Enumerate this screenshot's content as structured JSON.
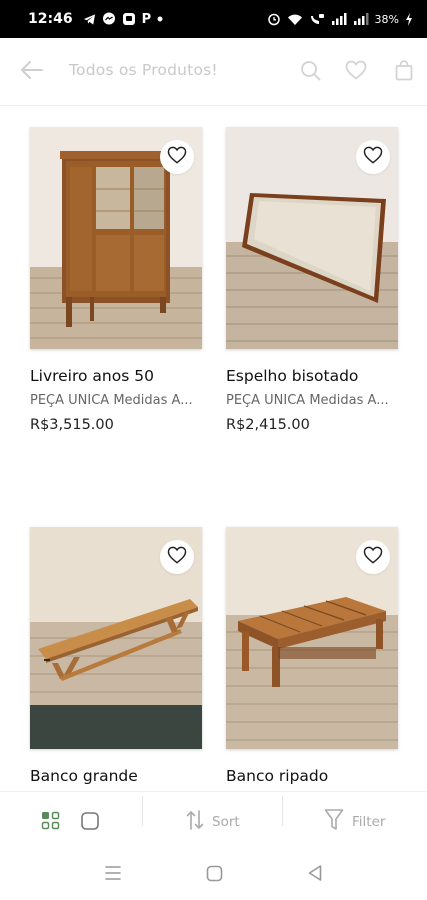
{
  "status_bar": {
    "time": "12:46",
    "left_icons": [
      "telegram-icon",
      "messenger-icon",
      "chat-app-icon",
      "p-app-icon",
      "dot-icon"
    ],
    "p_letter": "P",
    "battery": "38%",
    "right_icons": [
      "alarm-icon",
      "wifi-icon",
      "volte-icon",
      "signal-icon",
      "signal-icon",
      "battery-charging-icon"
    ]
  },
  "header": {
    "title": "Todos os Produtos!",
    "icons": [
      "back-arrow-icon",
      "search-icon",
      "heart-icon",
      "shopping-bag-icon"
    ]
  },
  "products": [
    {
      "title": "Livreiro anos 50",
      "description": "PEÇA ÚNICA Medidas A...",
      "price": "R$3,515.00",
      "image": "wooden-cabinet"
    },
    {
      "title": "Espelho bisotado",
      "description": "PEÇA ÚNICA Medidas A...",
      "price": "R$2,415.00",
      "image": "beveled-mirror"
    },
    {
      "title": "Banco grande",
      "description": "",
      "price": "",
      "image": "long-wooden-bench"
    },
    {
      "title": "Banco ripado",
      "description": "",
      "price": "",
      "image": "slatted-bench"
    }
  ],
  "toolbar": {
    "sort_label": "Sort",
    "filter_label": "Filter",
    "icons": [
      "grid-view-icon",
      "single-view-icon",
      "sort-icon",
      "filter-icon"
    ]
  },
  "navigation": {
    "icons": [
      "recent-apps-icon",
      "home-icon",
      "back-icon"
    ]
  },
  "colors": {
    "accent_muted": "#c9c9c9",
    "text": "#111111",
    "grid_icon_green": "#5a8a5a"
  }
}
